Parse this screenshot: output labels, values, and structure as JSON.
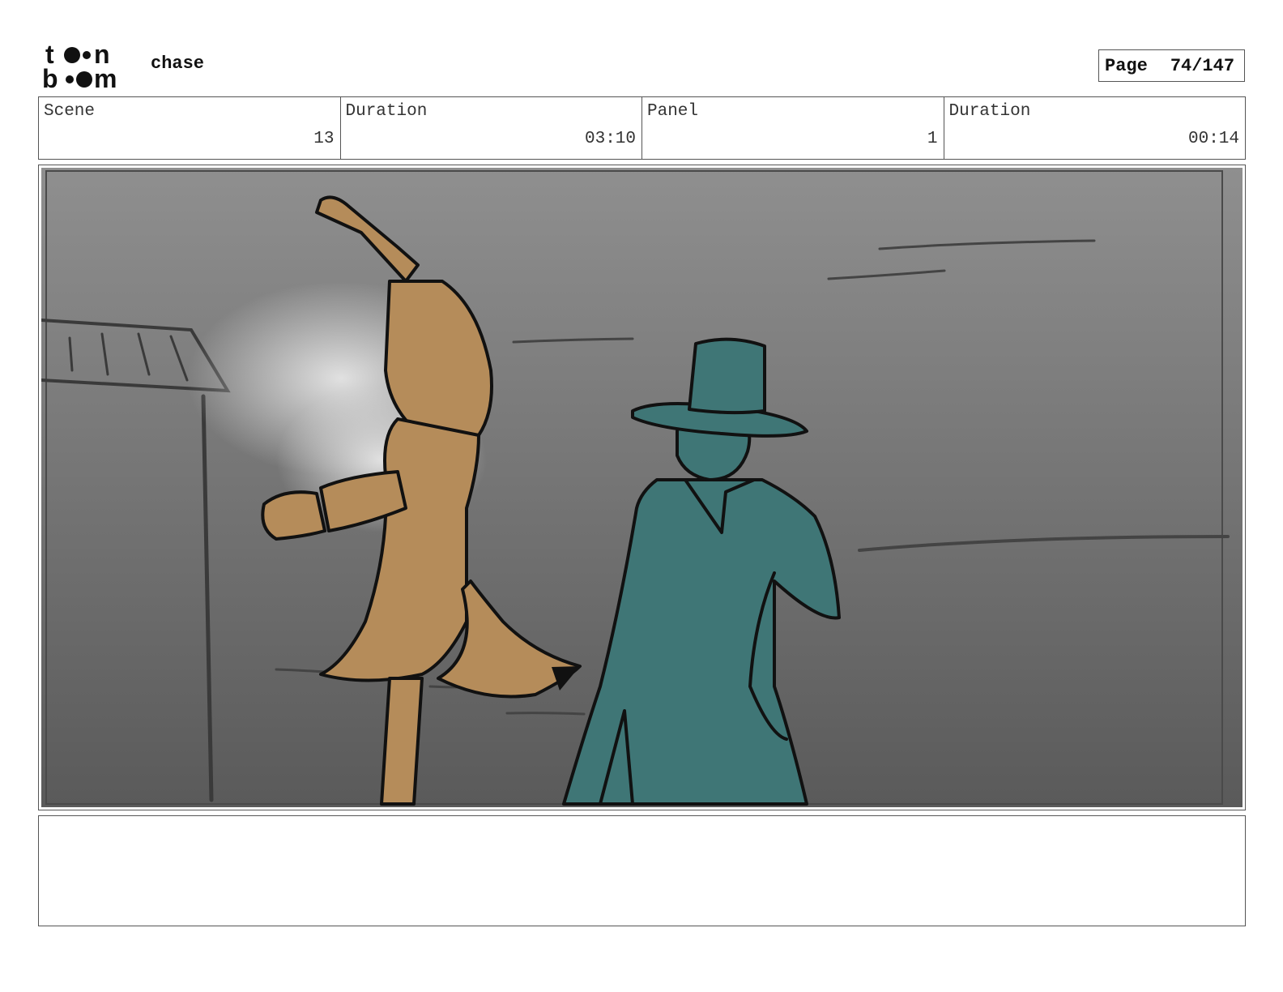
{
  "header": {
    "logo_text": "toon boom",
    "project_title": "chase",
    "page_label": "Page",
    "page_number": "74/147"
  },
  "info": {
    "scene_label": "Scene",
    "scene_value": "13",
    "scene_duration_label": "Duration",
    "scene_duration_value": "03:10",
    "panel_label": "Panel",
    "panel_value": "1",
    "panel_duration_label": "Duration",
    "panel_duration_value": "00:14"
  },
  "panel": {
    "colors": {
      "background_top": "#8f8f8f",
      "background_bottom": "#5a5a5a",
      "fox_coat": "#b58c5a",
      "detective_coat": "#3f7676",
      "line": "#111111"
    }
  },
  "notes": {}
}
